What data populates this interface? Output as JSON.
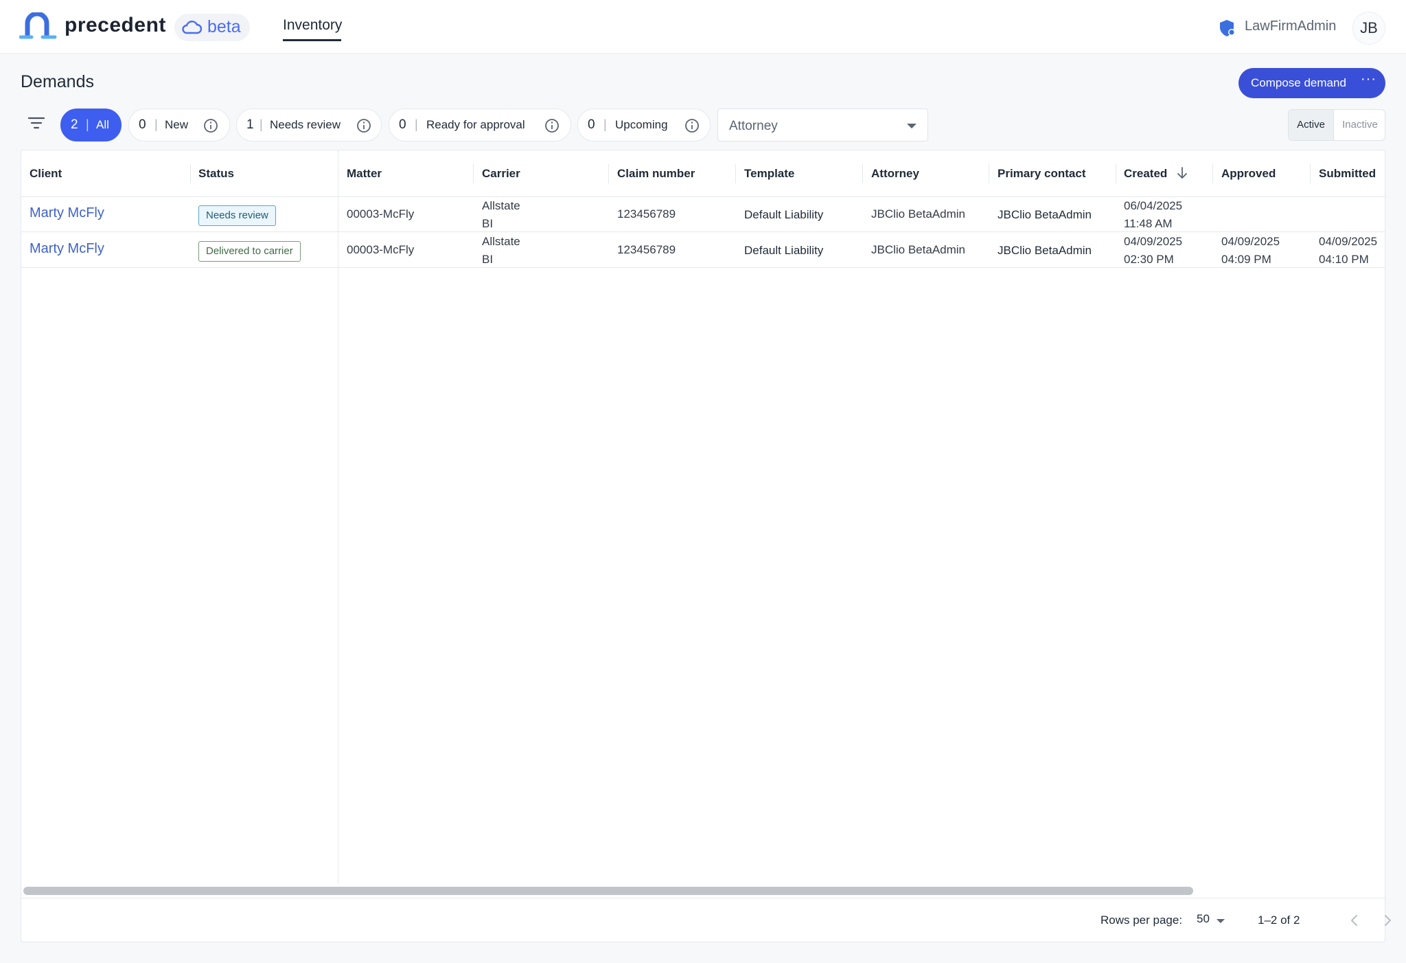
{
  "header": {
    "brand": "precedent",
    "beta_label": "beta",
    "nav_inventory": "Inventory",
    "admin_label": "LawFirmAdmin",
    "avatar_initials": "JB"
  },
  "page": {
    "title": "Demands",
    "compose_label": "Compose demand",
    "compose_more": "···"
  },
  "filters": {
    "chips": [
      {
        "count": "2",
        "label": "All"
      },
      {
        "count": "0",
        "label": "New"
      },
      {
        "count": "1",
        "label": "Needs review"
      },
      {
        "count": "0",
        "label": "Ready for approval"
      },
      {
        "count": "0",
        "label": "Upcoming"
      }
    ],
    "separator": "|",
    "attorney_placeholder": "Attorney",
    "toggle_active": "Active",
    "toggle_inactive": "Inactive"
  },
  "table": {
    "columns": [
      "Client",
      "Status",
      "Matter",
      "Carrier",
      "Claim number",
      "Template",
      "Attorney",
      "Primary contact",
      "Created",
      "Approved",
      "Submitted"
    ],
    "rows": [
      {
        "client": "Marty McFly",
        "status": "Needs review",
        "matter": "00003-McFly",
        "carrier_line1": "Allstate",
        "carrier_line2": "BI",
        "claim_number": "123456789",
        "template": "Default Liability",
        "attorney": "JBClio BetaAdmin",
        "primary_contact": "JBClio BetaAdmin",
        "created_date": "06/04/2025",
        "created_time": "11:48 AM",
        "approved_date": "",
        "approved_time": "",
        "submitted_date": "",
        "submitted_time": ""
      },
      {
        "client": "Marty McFly",
        "status": "Delivered to carrier",
        "matter": "00003-McFly",
        "carrier_line1": "Allstate",
        "carrier_line2": "BI",
        "claim_number": "123456789",
        "template": "Default Liability",
        "attorney": "JBClio BetaAdmin",
        "primary_contact": "JBClio BetaAdmin",
        "created_date": "04/09/2025",
        "created_time": "02:30 PM",
        "approved_date": "04/09/2025",
        "approved_time": "04:09 PM",
        "submitted_date": "04/09/2025",
        "submitted_time": "04:10 PM"
      }
    ]
  },
  "pagination": {
    "rows_per_page_label": "Rows per page:",
    "rows_per_page_value": "50",
    "range": "1–2 of 2"
  },
  "colors": {
    "primary": "#3e5ef0",
    "compose": "#3a4fd8",
    "link": "#3f62c8"
  }
}
